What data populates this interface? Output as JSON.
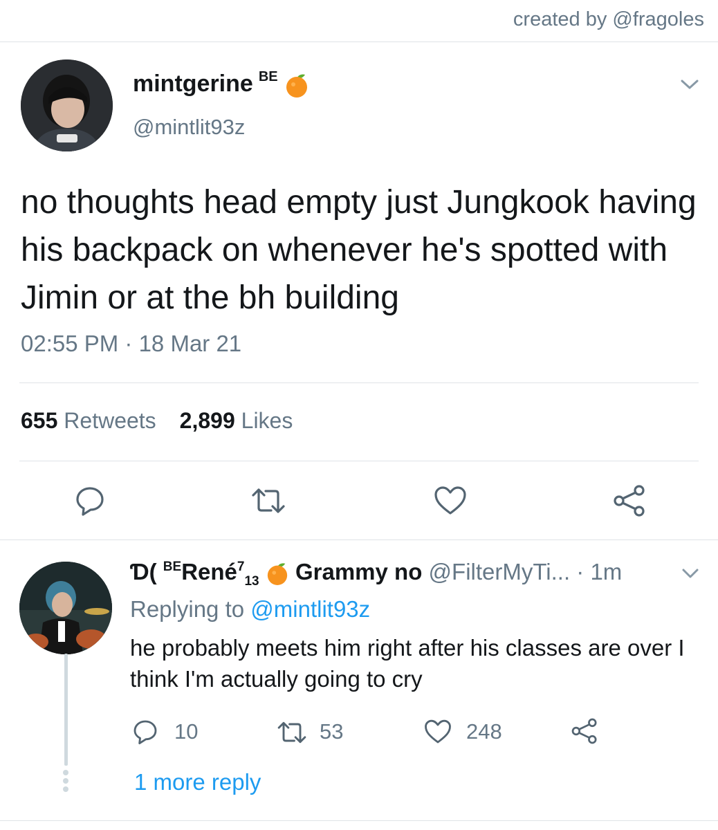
{
  "credit": "created by @fragoles",
  "tweet": {
    "display_name": "mintgerine",
    "name_suffix": "BE",
    "name_emoji_icon": "tangerine-icon",
    "handle": "@mintlit93z",
    "text": "no thoughts head empty just Jungkook having his backpack on whenever he's spotted with Jimin or at the bh building",
    "timestamp": "02:55 PM · 18 Mar 21",
    "retweets_count": "655",
    "retweets_label": "Retweets",
    "likes_count": "2,899",
    "likes_label": "Likes",
    "actions": [
      "reply-icon",
      "retweet-icon",
      "like-icon",
      "share-icon"
    ]
  },
  "reply": {
    "name_prefix_symbol": "Ɗ(",
    "name_sup": "BE",
    "name_main": "René",
    "name_sup2": "7",
    "name_sub": "13",
    "name_tail": "Grammy no",
    "handle": "@FilterMyTi...",
    "time": "· 1m",
    "replying_label": "Replying to",
    "replying_to": "@mintlit93z",
    "text": "he probably meets him right after his classes are over I think I'm actually going to cry",
    "reply_count": "10",
    "retweet_count": "53",
    "like_count": "248",
    "more_replies": "1 more reply"
  },
  "colors": {
    "text": "#14171a",
    "muted": "#657786",
    "link": "#1d9bf0",
    "divider": "#dfe3e7"
  }
}
